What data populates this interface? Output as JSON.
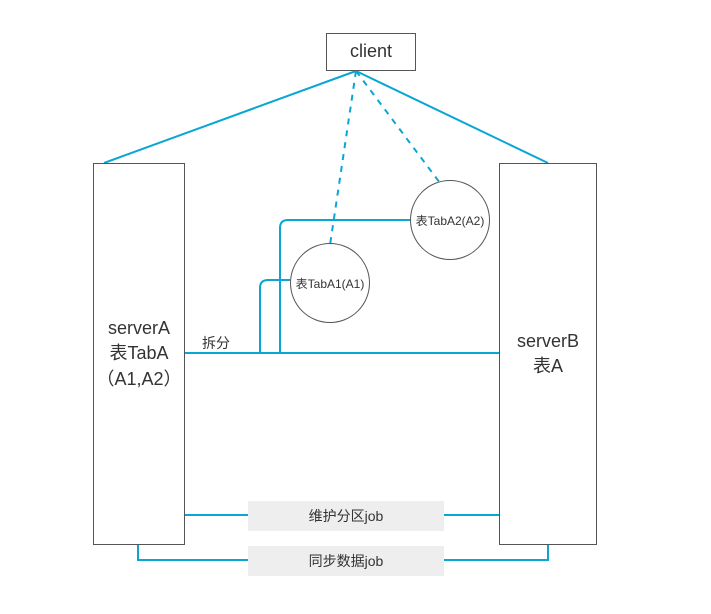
{
  "accent_color": "#09a6d4",
  "client": {
    "label": "client"
  },
  "serverA": {
    "name": "serverA",
    "table": "表TabA",
    "cols": "（A1,A2）"
  },
  "serverB": {
    "name": "serverB",
    "table": "表A"
  },
  "split_label": "拆分",
  "virtual_tables": {
    "a1": "表TabA1(A1)",
    "a2": "表TabA2(A2)"
  },
  "jobs": {
    "maintain": "维护分区job",
    "sync": "同步数据job"
  }
}
